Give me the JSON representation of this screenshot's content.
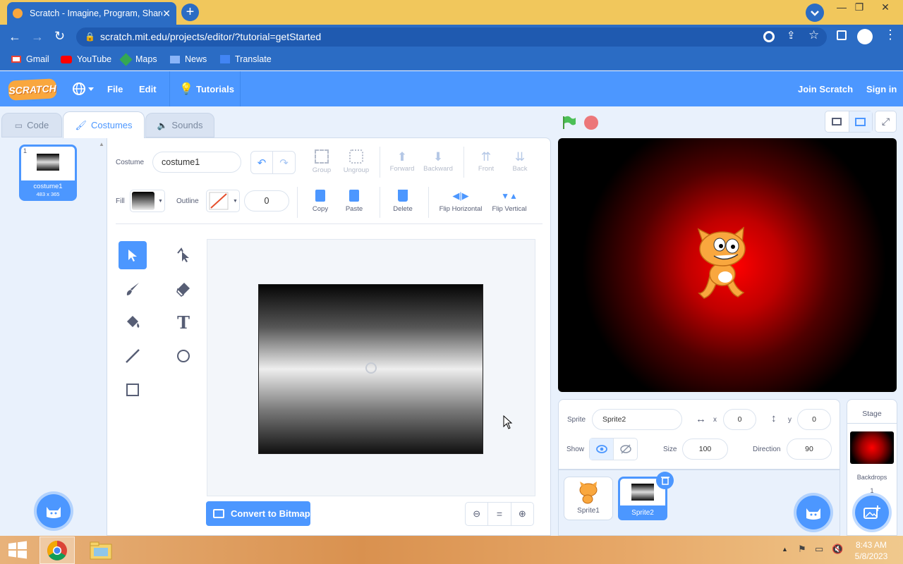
{
  "browser": {
    "tab_title": "Scratch - Imagine, Program, Share",
    "url": "scratch.mit.edu/projects/editor/?tutorial=getStarted",
    "bookmarks": [
      "Gmail",
      "YouTube",
      "Maps",
      "News",
      "Translate"
    ],
    "colors": {
      "tabbar": "#f1c75c",
      "chrome": "#2b6cc4"
    }
  },
  "menubar": {
    "logo": "SCRATCH",
    "file": "File",
    "edit": "Edit",
    "tutorials": "Tutorials",
    "join": "Join Scratch",
    "signin": "Sign in",
    "accent": "#4c97ff"
  },
  "editor_tabs": {
    "code": "Code",
    "costumes": "Costumes",
    "sounds": "Sounds"
  },
  "costume_list": [
    {
      "index": "1",
      "name": "costume1",
      "size": "483 x 365"
    }
  ],
  "paint": {
    "costume_label": "Costume",
    "costume_name": "costume1",
    "fill_label": "Fill",
    "outline_label": "Outline",
    "outline_width": "0",
    "buttons": {
      "group": "Group",
      "ungroup": "Ungroup",
      "forward": "Forward",
      "backward": "Backward",
      "front": "Front",
      "back": "Back",
      "copy": "Copy",
      "paste": "Paste",
      "delete": "Delete",
      "flip_h": "Flip Horizontal",
      "flip_v": "Flip Vertical"
    },
    "convert": "Convert to Bitmap",
    "zoom_reset": "="
  },
  "sprite_info": {
    "sprite_label": "Sprite",
    "sprite_name": "Sprite2",
    "x_label": "x",
    "x": "0",
    "y_label": "y",
    "y": "0",
    "show_label": "Show",
    "size_label": "Size",
    "size": "100",
    "direction_label": "Direction",
    "direction": "90"
  },
  "sprites": [
    {
      "name": "Sprite1",
      "selected": false
    },
    {
      "name": "Sprite2",
      "selected": true
    }
  ],
  "stage_pane": {
    "title": "Stage",
    "backdrops_label": "Backdrops",
    "backdrops_count": "1"
  },
  "taskbar": {
    "time": "8:43 AM",
    "date": "5/8/2023"
  }
}
